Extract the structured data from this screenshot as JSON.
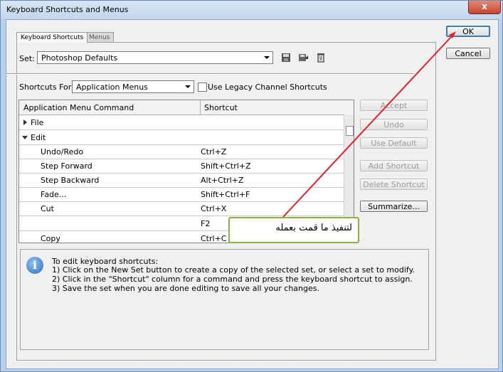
{
  "window": {
    "title": "Keyboard Shortcuts and Menus",
    "close_glyph": "x"
  },
  "tabs": [
    {
      "label": "Keyboard Shortcuts",
      "active": true
    },
    {
      "label": "Menus",
      "active": false
    }
  ],
  "set": {
    "label": "Set:",
    "value": "Photoshop Defaults"
  },
  "shortcuts_for": {
    "label": "Shortcuts For:",
    "value": "Application Menus",
    "legacy_checkbox_label": "Use Legacy Channel Shortcuts",
    "legacy_checked": false
  },
  "table": {
    "headers": {
      "command": "Application Menu Command",
      "shortcut": "Shortcut"
    },
    "groups": [
      {
        "label": "File",
        "expanded": false
      },
      {
        "label": "Edit",
        "expanded": true
      }
    ],
    "rows": [
      {
        "command": "Undo/Redo",
        "shortcut": "Ctrl+Z"
      },
      {
        "command": "Step Forward",
        "shortcut": "Shift+Ctrl+Z"
      },
      {
        "command": "Step Backward",
        "shortcut": "Alt+Ctrl+Z"
      },
      {
        "command": "Fade...",
        "shortcut": "Shift+Ctrl+F"
      },
      {
        "command": "Cut",
        "shortcut": "Ctrl+X"
      },
      {
        "command": "",
        "shortcut": "F2"
      },
      {
        "command": "Copy",
        "shortcut": "Ctrl+C"
      }
    ]
  },
  "side_buttons": {
    "accept": "Accept",
    "undo": "Undo",
    "use_default": "Use Default",
    "add_shortcut": "Add Shortcut",
    "delete_shortcut": "Delete Shortcut",
    "summarize": "Summarize..."
  },
  "dialog_buttons": {
    "ok": "OK",
    "cancel": "Cancel"
  },
  "help": {
    "lines": [
      "To edit keyboard shortcuts:",
      "1) Click on the New Set button to create a copy of the selected set, or select a set to modify.",
      "2) Click in the \"Shortcut\" column for a command and press the keyboard shortcut to assign.",
      "3) Save the set when you are done editing to save all your changes."
    ]
  },
  "annotation": {
    "text": "لتنفيذ ما قمت بعمله",
    "arrow_color": "#e8202a",
    "border_color": "#8ab43c"
  },
  "icons": {
    "save": "save-icon",
    "save_as": "save-as-icon",
    "delete": "trash-icon",
    "info": "info-icon"
  },
  "colors": {
    "title_bar": "#c2d6ec",
    "client": "#f0f0f0",
    "default_button_border": "#3c7fb1"
  }
}
